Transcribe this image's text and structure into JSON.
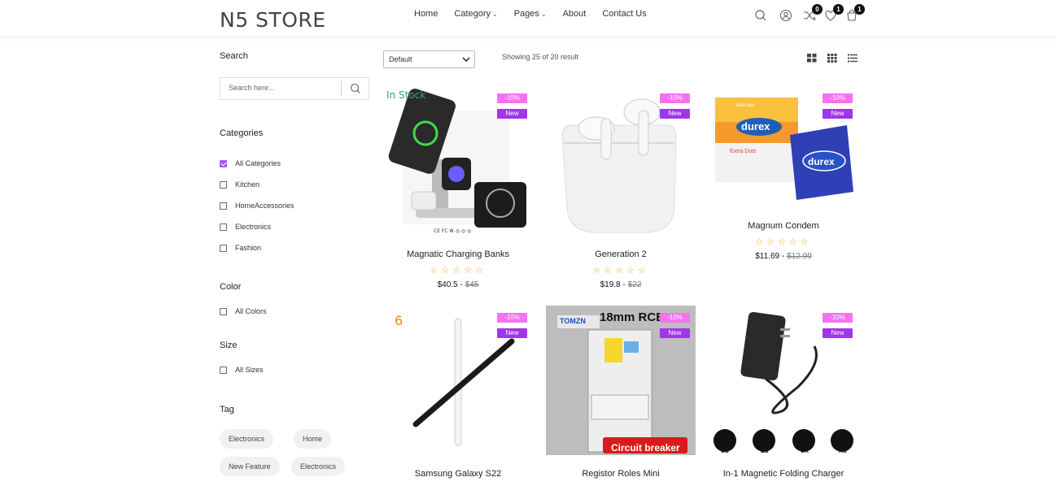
{
  "header": {
    "logo": "N5 STORE",
    "nav": [
      {
        "label": "Home",
        "dropdown": false
      },
      {
        "label": "Category",
        "dropdown": true
      },
      {
        "label": "Pages",
        "dropdown": true
      },
      {
        "label": "About",
        "dropdown": false
      },
      {
        "label": "Contact Us",
        "dropdown": false
      }
    ],
    "icons": [
      "search-icon",
      "user-icon",
      "compare-icon",
      "wishlist-icon",
      "cart-icon"
    ],
    "badges": {
      "compare": "0",
      "wishlist": "1",
      "cart": "1"
    }
  },
  "sidebar": {
    "search_title": "Search",
    "search_placeholder": "Search here...",
    "categories_title": "Categories",
    "categories": [
      {
        "label": "All Categories",
        "checked": true
      },
      {
        "label": "Kitchen",
        "checked": false
      },
      {
        "label": "HomeAccessories",
        "checked": false
      },
      {
        "label": "Electronics",
        "checked": false
      },
      {
        "label": "Fashion",
        "checked": false
      }
    ],
    "color_title": "Color",
    "colors": [
      {
        "label": "All Colors",
        "checked": false
      }
    ],
    "size_title": "Size",
    "sizes": [
      {
        "label": "All Sizes",
        "checked": false
      }
    ],
    "tag_title": "Tag",
    "tags": [
      "Electronics",
      "Home",
      "New Feature",
      "Electronics"
    ]
  },
  "toolbar": {
    "sort_value": "Default",
    "showing": "Showing 25 of 20 result"
  },
  "products": [
    {
      "name": "Magnatic Charging Banks",
      "price": "$40.5 -",
      "old_price": "$45",
      "discount": "-10%",
      "badge": "New",
      "rating": "☆☆☆☆☆",
      "overlay": "In Stock"
    },
    {
      "name": "Generation 2",
      "price": "$19.8 -",
      "old_price": "$22",
      "discount": "-10%",
      "badge": "New",
      "rating": "☆☆☆☆☆"
    },
    {
      "name": "Magnum Condem",
      "price": "$11.69 -",
      "old_price": "$12.99",
      "discount": "-10%",
      "badge": "New",
      "rating": "☆☆☆☆☆",
      "img_text": {
        "brand": "durex",
        "line1": "Extra Dots",
        "top": "love sex"
      }
    },
    {
      "name": "Samsung Galaxy S22",
      "discount": "-10%",
      "badge": "New"
    },
    {
      "name": "Registor Roles Mini",
      "discount": "-10%",
      "badge": "New",
      "img_text": {
        "top": "18mm RCB",
        "brand": "TOMZN",
        "bottom": "Circuit breaker"
      }
    },
    {
      "name": "In-1 Magnetic Folding Charger",
      "discount": "-10%",
      "badge": "New",
      "img_text": {
        "plugs": [
          "US",
          "EU",
          "UK",
          "AU"
        ]
      }
    }
  ],
  "colors": {
    "discount": "#f472f0",
    "new": "#a035ec",
    "accent": "#a855f7"
  }
}
